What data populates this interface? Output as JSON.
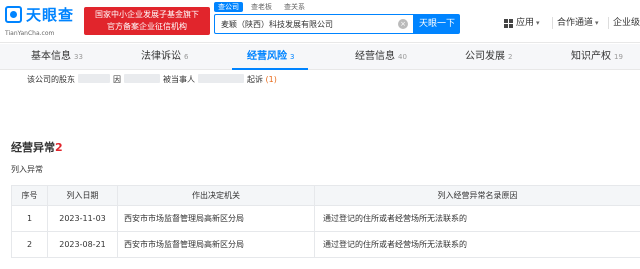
{
  "header": {
    "logo_text": "天眼查",
    "logo_sub": "TianYanCha.com",
    "banner_line1": "国家中小企业发展子基金旗下",
    "banner_line2": "官方备案企业征信机构",
    "search_tabs": [
      "查公司",
      "查老板",
      "查关系"
    ],
    "search_value": "麦颖（陕西）科技发展有限公司",
    "search_button": "天眼一下",
    "nav_app": "应用",
    "nav_partner": "合作通道",
    "nav_enterprise": "企业级产品"
  },
  "tabs": [
    {
      "label": "基本信息",
      "count": "33"
    },
    {
      "label": "法律诉讼",
      "count": "6"
    },
    {
      "label": "经营风险",
      "count": "3"
    },
    {
      "label": "经营信息",
      "count": "40"
    },
    {
      "label": "公司发展",
      "count": "2"
    },
    {
      "label": "知识产权",
      "count": "19"
    }
  ],
  "suit_line": {
    "part1": "该公司的股东",
    "part2": "因",
    "part3": "被当事人",
    "part4": "起诉",
    "count": "(1)"
  },
  "section": {
    "title": "经营异常",
    "count": "2",
    "subtitle": "列入异常"
  },
  "table": {
    "headers": [
      "序号",
      "列入日期",
      "作出决定机关",
      "列入经营异常名录原因"
    ],
    "rows": [
      {
        "idx": "1",
        "date": "2023-11-03",
        "org": "西安市市场监督管理局高新区分局",
        "reason": "通过登记的住所或者经营场所无法联系的"
      },
      {
        "idx": "2",
        "date": "2023-08-21",
        "org": "西安市市场监督管理局高新区分局",
        "reason": "通过登记的住所或者经营场所无法联系的"
      }
    ]
  },
  "colors": {
    "brand_blue": "#0084ff",
    "banner_red": "#e1252c",
    "count_red": "#e1252c"
  }
}
